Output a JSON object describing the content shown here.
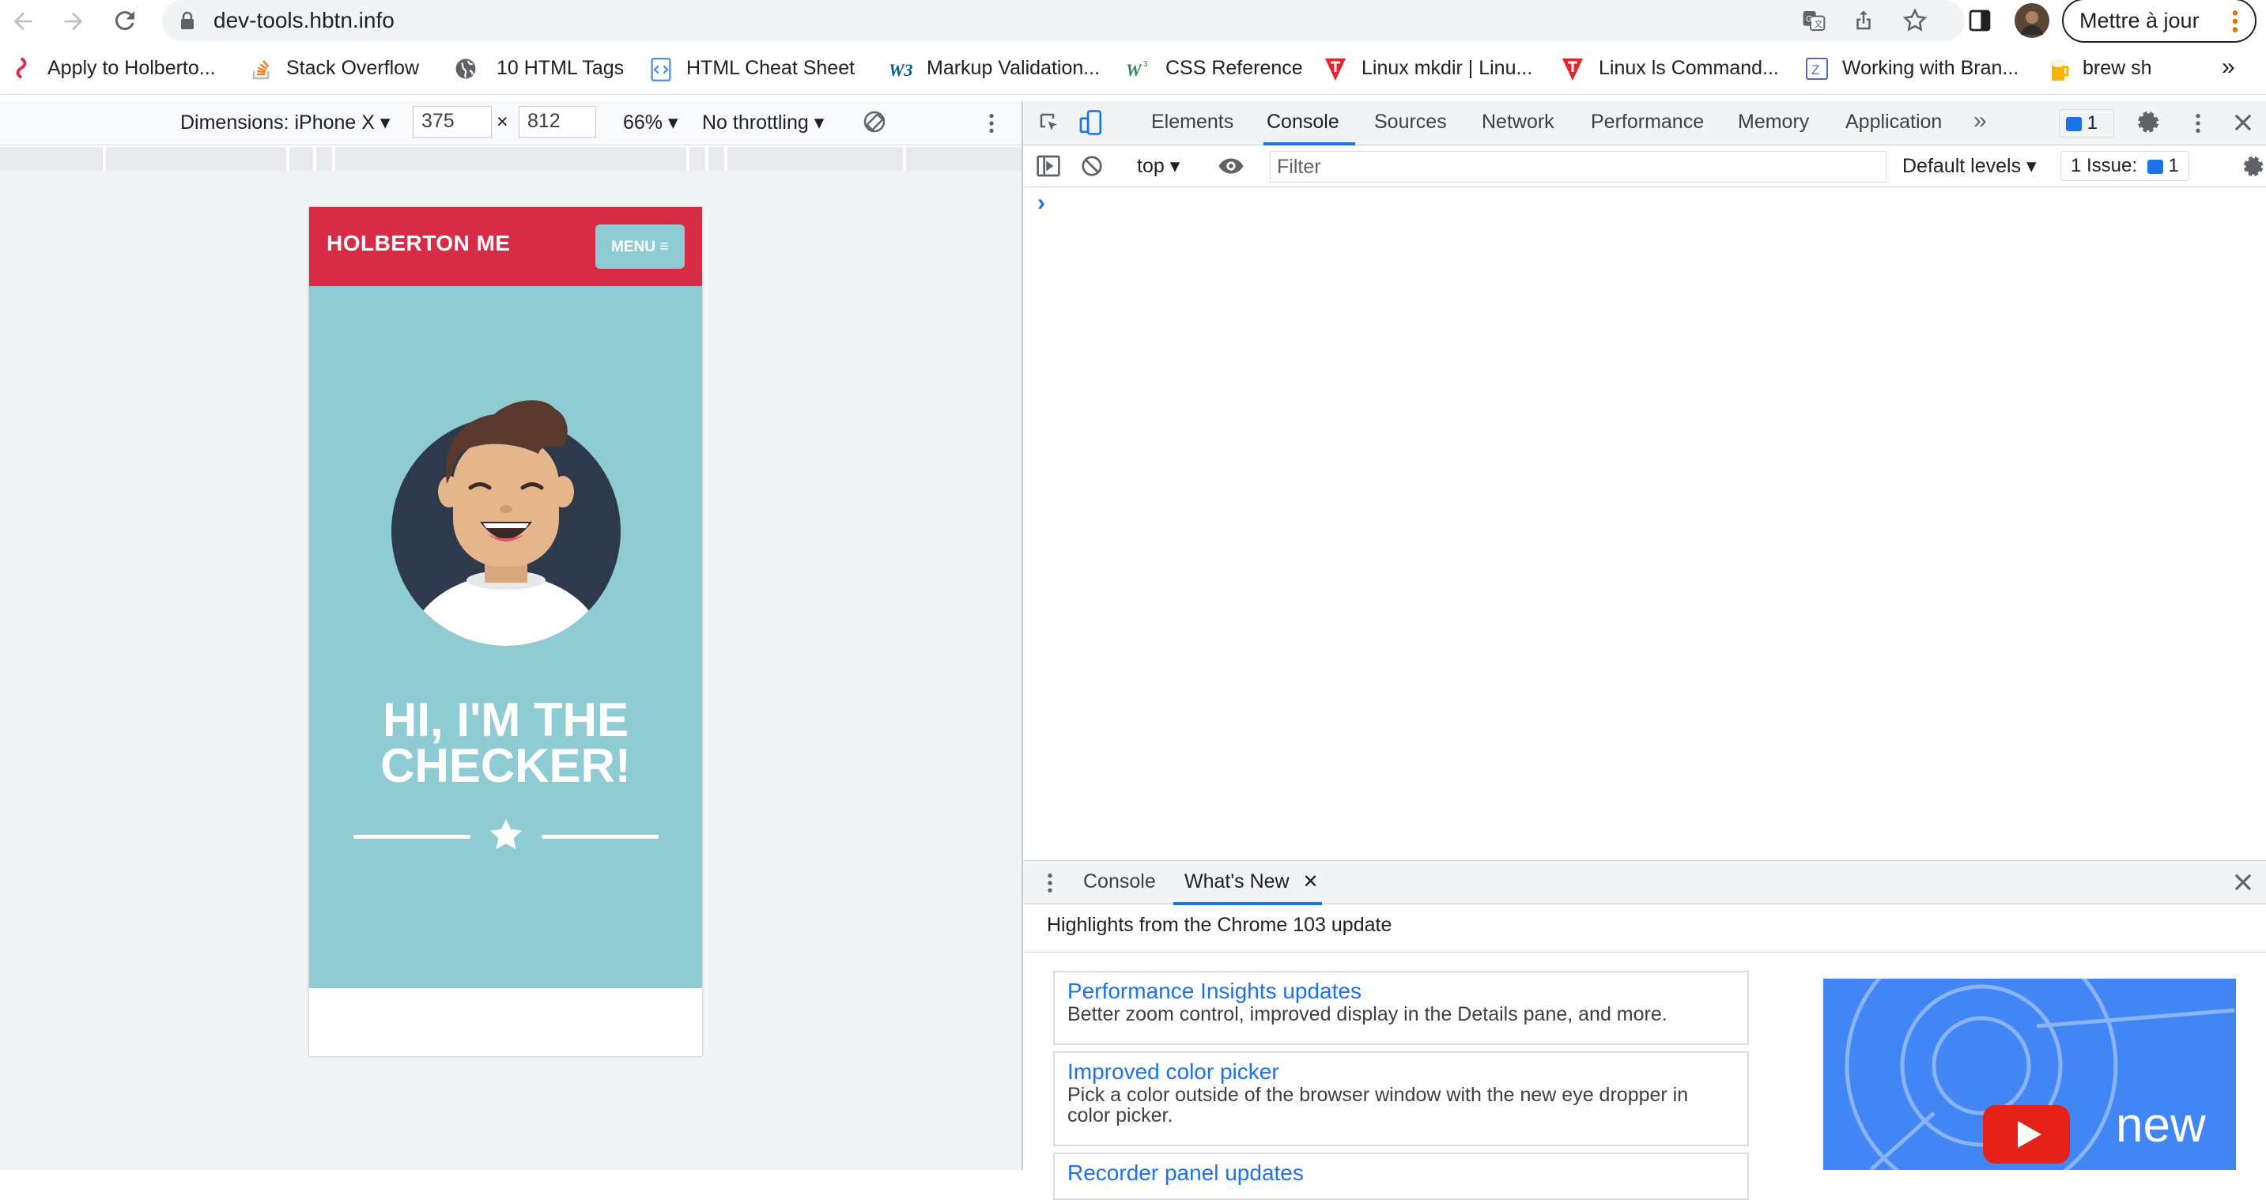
{
  "browser": {
    "url": "dev-tools.hbtn.info",
    "update_button": "Mettre à jour"
  },
  "bookmarks": [
    {
      "label": "Apply to Holberto...",
      "icon": "holberton-icon"
    },
    {
      "label": "Stack Overflow",
      "icon": "stackoverflow-icon"
    },
    {
      "label": "10 HTML Tags",
      "icon": "globe-icon"
    },
    {
      "label": "HTML Cheat Sheet",
      "icon": "code-icon"
    },
    {
      "label": "Markup Validation...",
      "icon": "w3c-icon"
    },
    {
      "label": "CSS Reference",
      "icon": "css-icon"
    },
    {
      "label": "Linux mkdir | Linu...",
      "icon": "linux-tutorial-icon"
    },
    {
      "label": "Linux ls Command...",
      "icon": "linux-tutorial-icon"
    },
    {
      "label": "Working with Bran...",
      "icon": "z-icon"
    },
    {
      "label": "brew sh",
      "icon": "beer-icon"
    }
  ],
  "device_toolbar": {
    "dimensions_label": "Dimensions: iPhone X",
    "width": "375",
    "times": "×",
    "height": "812",
    "zoom": "66%",
    "throttling": "No throttling"
  },
  "page": {
    "brand": "HOLBERTON ME",
    "menu_label": "MENU",
    "heading_line1": "HI, I'M THE",
    "heading_line2": "CHECKER!",
    "header_color": "#d72b46",
    "hero_color": "#8fcbd3"
  },
  "devtools": {
    "tabs": [
      "Elements",
      "Console",
      "Sources",
      "Network",
      "Performance",
      "Memory",
      "Application"
    ],
    "active_tab": "Console",
    "issues_badge": "1",
    "context": "top",
    "filter_placeholder": "Filter",
    "levels": "Default levels",
    "issue_count": "1 Issue:",
    "issue_count_badge": "1",
    "prompt": "›",
    "drawer": {
      "tabs": [
        "Console",
        "What's New"
      ],
      "active_tab": "What's New",
      "subtitle": "Highlights from the Chrome 103 update",
      "cards": [
        {
          "title": "Performance Insights updates",
          "desc": "Better zoom control, improved display in the Details pane, and more."
        },
        {
          "title": "Improved color picker",
          "desc": "Pick a color outside of the browser window with the new eye dropper in color picker."
        },
        {
          "title": "Recorder panel updates",
          "desc": ""
        }
      ],
      "promo_text": "new"
    }
  }
}
